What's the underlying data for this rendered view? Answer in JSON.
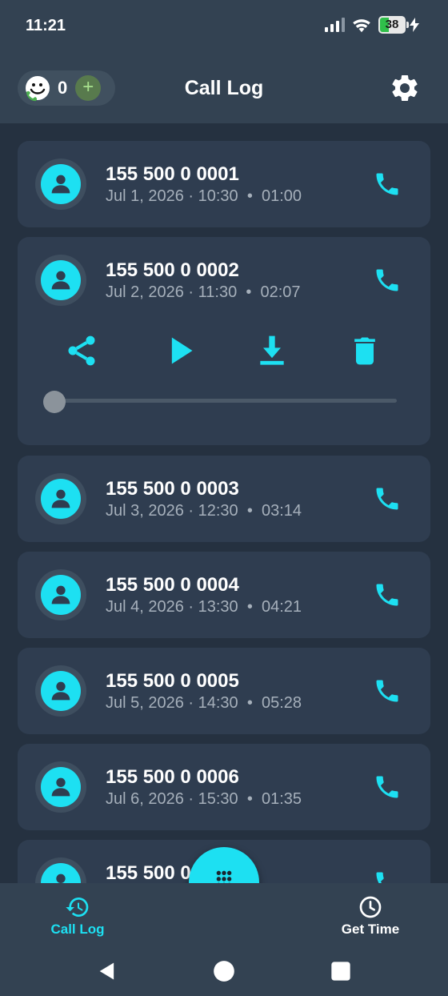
{
  "status_bar": {
    "time": "11:21",
    "battery": "38",
    "battery_level": 0.38
  },
  "app_bar": {
    "credit_count": "0",
    "add_label": "+",
    "title": "Call Log"
  },
  "calls": [
    {
      "number": "155 500 0 0001",
      "date": "Jul 1, 2026 · 10:30",
      "duration": "01:00",
      "expanded": false
    },
    {
      "number": "155 500 0 0002",
      "date": "Jul 2, 2026 · 11:30",
      "duration": "02:07",
      "expanded": true,
      "playback_progress": 0.0
    },
    {
      "number": "155 500 0 0003",
      "date": "Jul 3, 2026 · 12:30",
      "duration": "03:14",
      "expanded": false
    },
    {
      "number": "155 500 0 0004",
      "date": "Jul 4, 2026 · 13:30",
      "duration": "04:21",
      "expanded": false
    },
    {
      "number": "155 500 0 0005",
      "date": "Jul 5, 2026 · 14:30",
      "duration": "05:28",
      "expanded": false
    },
    {
      "number": "155 500 0 0006",
      "date": "Jul 6, 2026 · 15:30",
      "duration": "01:35",
      "expanded": false
    },
    {
      "number": "155 500 0",
      "date": "",
      "duration": "",
      "expanded": false
    }
  ],
  "meta_separator": "•",
  "actions": [
    "share-icon",
    "play-icon",
    "download-icon",
    "delete-icon"
  ],
  "bottom_nav": {
    "call_log": {
      "label": "Call Log",
      "active": true
    },
    "get_time": {
      "label": "Get Time",
      "active": false
    }
  },
  "colors": {
    "accent": "#1de0f2",
    "background": "#253140",
    "surface": "#2f3d50",
    "bar": "#334252",
    "secondary_text": "#a6b0bb"
  }
}
